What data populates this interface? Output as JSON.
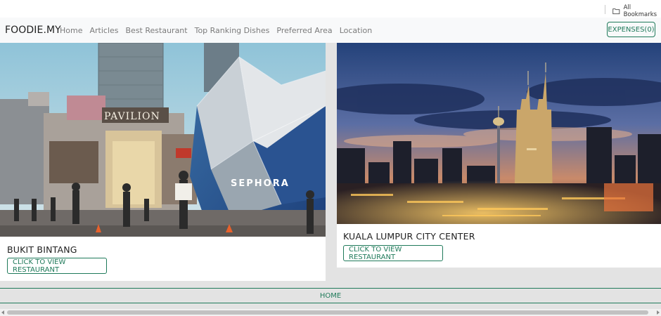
{
  "bookmarks": {
    "all_label": "All Bookmarks"
  },
  "navbar": {
    "brand": "FOODIE.MY",
    "links": [
      "Home",
      "Articles",
      "Best Restaurant",
      "Top Ranking Dishes",
      "Preferred Area",
      "Location"
    ],
    "expenses_label": "EXPENSES(0)"
  },
  "cards": [
    {
      "title": "BUKIT BINTANG",
      "button_label": "CLICK TO VIEW RESTAURANT",
      "photo_signs": [
        "PAVILION",
        "SEPHORA"
      ]
    },
    {
      "title": "KUALA LUMPUR CITY CENTER",
      "button_label": "CLICK TO VIEW RESTAURANT"
    }
  ],
  "footer": {
    "home_label": "HOME"
  },
  "colors": {
    "accent": "#1f7a5a",
    "navbar_bg": "#f8f9fa",
    "page_bg": "#e3e3e3"
  }
}
